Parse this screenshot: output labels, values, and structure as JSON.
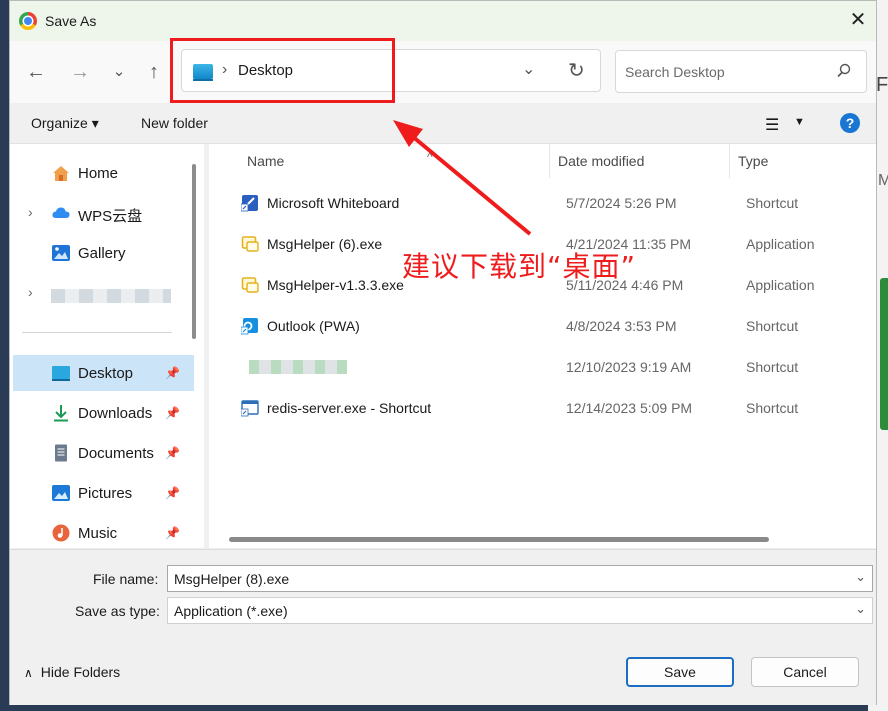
{
  "window": {
    "title": "Save As"
  },
  "address": {
    "path": "Desktop"
  },
  "search": {
    "placeholder": "Search Desktop"
  },
  "toolbar": {
    "organize": "Organize",
    "new_folder": "New folder"
  },
  "sidebar": {
    "items": [
      {
        "label": "Home",
        "icon": "home-icon",
        "pinned": false,
        "expandable": false
      },
      {
        "label": "WPS云盘",
        "icon": "cloud-icon",
        "pinned": false,
        "expandable": true
      },
      {
        "label": "Gallery",
        "icon": "gallery-icon",
        "pinned": false,
        "expandable": false
      },
      {
        "label": "",
        "icon": "blurred-item",
        "pinned": false,
        "expandable": true
      },
      {
        "label": "Desktop",
        "icon": "desktop-icon",
        "pinned": true,
        "selected": true
      },
      {
        "label": "Downloads",
        "icon": "download-icon",
        "pinned": true
      },
      {
        "label": "Documents",
        "icon": "documents-icon",
        "pinned": true
      },
      {
        "label": "Pictures",
        "icon": "pictures-icon",
        "pinned": true
      },
      {
        "label": "Music",
        "icon": "music-icon",
        "pinned": true
      }
    ]
  },
  "columns": {
    "name": "Name",
    "date": "Date modified",
    "type": "Type"
  },
  "files": [
    {
      "name": "Microsoft Whiteboard",
      "date": "5/7/2024 5:26 PM",
      "type": "Shortcut",
      "icon": "whiteboard-icon"
    },
    {
      "name": "MsgHelper (6).exe",
      "date": "4/21/2024 11:35 PM",
      "type": "Application",
      "icon": "exe-icon"
    },
    {
      "name": "MsgHelper-v1.3.3.exe",
      "date": "5/11/2024 4:46 PM",
      "type": "Application",
      "icon": "exe-icon"
    },
    {
      "name": "Outlook (PWA)",
      "date": "4/8/2024 3:53 PM",
      "type": "Shortcut",
      "icon": "outlook-icon"
    },
    {
      "name": "",
      "date": "12/10/2023 9:19 AM",
      "type": "Shortcut",
      "icon": "blurred-item"
    },
    {
      "name": "redis-server.exe - Shortcut",
      "date": "12/14/2023 5:09 PM",
      "type": "Shortcut",
      "icon": "shortcut-icon"
    }
  ],
  "annotation": {
    "text": "建议下载到“桌面”",
    "color": "#ee1c1c"
  },
  "form": {
    "file_name_label": "File name:",
    "file_name_value": "MsgHelper (8).exe",
    "save_type_label": "Save as type:",
    "save_type_value": "Application (*.exe)"
  },
  "buttons": {
    "hide_folders": "Hide Folders",
    "save": "Save",
    "cancel": "Cancel"
  },
  "colors": {
    "accent": "#1b6ec2",
    "selection": "#cce4f7",
    "highlight_red": "#ee1c1c"
  }
}
